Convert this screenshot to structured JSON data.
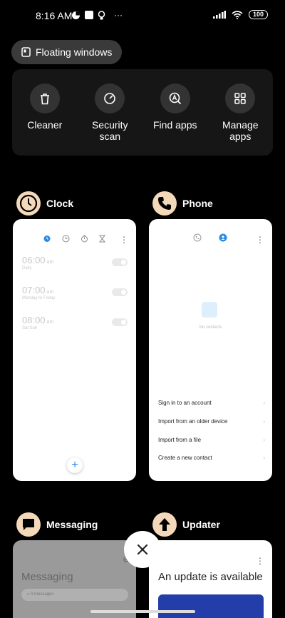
{
  "status_bar": {
    "time": "8:16 AM",
    "more": "···",
    "battery": "100"
  },
  "floating_windows": {
    "label": "Floating windows"
  },
  "tools": [
    {
      "label": "Cleaner",
      "icon": "trash-icon"
    },
    {
      "label": "Security\nscan",
      "icon": "security-scan-icon"
    },
    {
      "label": "Find apps",
      "icon": "find-apps-icon"
    },
    {
      "label": "Manage\napps",
      "icon": "grid-icon"
    }
  ],
  "apps": {
    "clock": {
      "name": "Clock",
      "alarms": [
        {
          "time": "06:00",
          "ampm": "am",
          "repeat": "Daily"
        },
        {
          "time": "07:00",
          "ampm": "am",
          "repeat": "Monday to Friday"
        },
        {
          "time": "08:00",
          "ampm": "am",
          "repeat": "Sat Sun"
        }
      ],
      "fab": "+"
    },
    "phone": {
      "name": "Phone",
      "empty_text": "No contacts",
      "links": [
        "Sign in to an account",
        "Import from an older device",
        "Import from a file",
        "Create a new contact"
      ],
      "chevron": "›"
    },
    "messaging": {
      "name": "Messaging",
      "title": "Messaging",
      "search_placeholder": "0 messages"
    },
    "updater": {
      "name": "Updater",
      "title": "An update is available"
    }
  },
  "colors": {
    "app_icon_bg": "#f3d9b9",
    "accent_blue": "#2a8ae3",
    "panel_bg": "#161616"
  }
}
